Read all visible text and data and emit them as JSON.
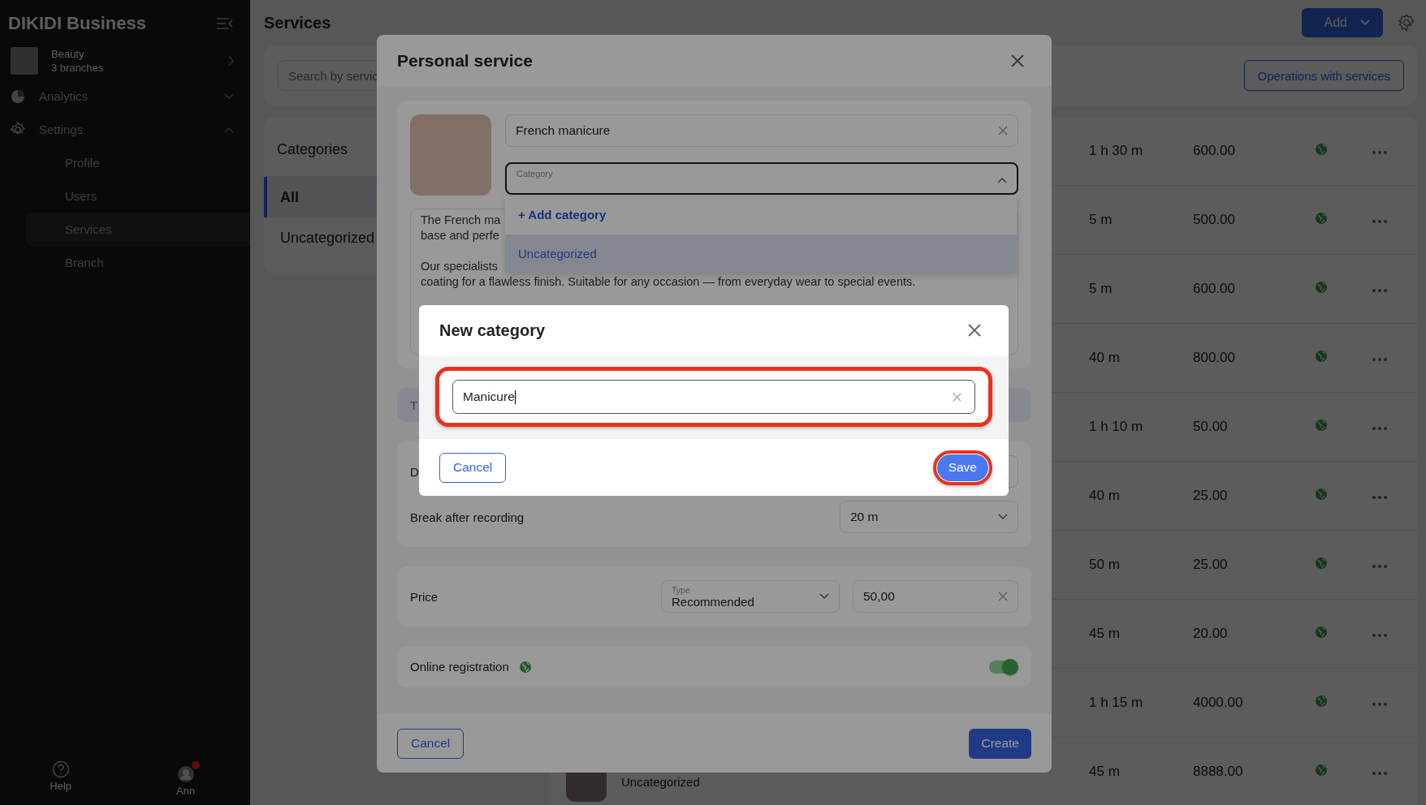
{
  "sidebar": {
    "brand": "DIKIDI Business",
    "account": {
      "name": "Beauty",
      "subtitle": "3 branches"
    },
    "items": [
      {
        "label": "Analytics",
        "kind": "analytics",
        "expanded": false
      },
      {
        "label": "Settings",
        "kind": "settings",
        "expanded": true,
        "children": [
          {
            "label": "Profile",
            "selected": false
          },
          {
            "label": "Users",
            "selected": false
          },
          {
            "label": "Services",
            "selected": true
          },
          {
            "label": "Branch",
            "selected": false
          }
        ]
      }
    ],
    "footer": [
      {
        "label": "Help",
        "kind": "help"
      },
      {
        "label": "Ann",
        "kind": "user",
        "notification": true
      }
    ]
  },
  "header": {
    "title": "Services",
    "add_button": "Add"
  },
  "toolbar": {
    "search": {
      "placeholder": "Search by servic"
    },
    "operations_button": "Operations with services"
  },
  "categories": {
    "title": "Categories",
    "items": [
      {
        "label": "All",
        "selected": true
      },
      {
        "label": "Uncategorized",
        "selected": false
      }
    ]
  },
  "services_table": {
    "rows": [
      {
        "duration": "1 h 30 m",
        "price": "600.00",
        "online": true
      },
      {
        "duration": "5 m",
        "price": "500.00",
        "online": true
      },
      {
        "duration": "5 m",
        "price": "600.00",
        "online": true
      },
      {
        "duration": "40 m",
        "price": "800.00",
        "online": true
      },
      {
        "duration": "1 h 10 m",
        "price": "50.00",
        "online": true
      },
      {
        "duration": "40 m",
        "price": "25.00",
        "online": true
      },
      {
        "duration": "50 m",
        "price": "25.00",
        "online": true
      },
      {
        "duration": "45 m",
        "price": "20.00",
        "online": true
      },
      {
        "duration": "1 h 15 m",
        "price": "4000.00",
        "online": true
      },
      {
        "category": "Uncategorized",
        "duration": "45 m",
        "price": "8888.00",
        "online": true
      }
    ]
  },
  "personal_service": {
    "title": "Personal service",
    "name": {
      "value": "French manicure"
    },
    "category": {
      "label": "Category",
      "expanded": true,
      "options": [
        {
          "label": "+ Add category",
          "kind": "action",
          "selected": false
        },
        {
          "label": "Uncategorized",
          "kind": "option",
          "selected": true
        }
      ]
    },
    "description": {
      "paragraphs": [
        {
          "lines": [
            "The French ma",
            "base and perfe"
          ]
        },
        {
          "lines": [
            "Our specialists",
            "coating for a flawless finish. Suitable for any occasion — from everyday wear to special events."
          ]
        }
      ]
    },
    "section_t": "T",
    "duration_label": "D",
    "break": {
      "label": "Break after recording",
      "value": "20 m"
    },
    "price": {
      "label": "Price",
      "type_label": "Type",
      "type_value": "Recommended",
      "value": "50,00"
    },
    "online_registration": {
      "label": "Online registration",
      "on": true
    },
    "cancel": "Cancel",
    "create": "Create"
  },
  "new_category": {
    "title": "New category",
    "input": {
      "value": "Manicure",
      "highlighted": true
    },
    "cancel": "Cancel",
    "save": "Save",
    "save_highlighted": true
  }
}
